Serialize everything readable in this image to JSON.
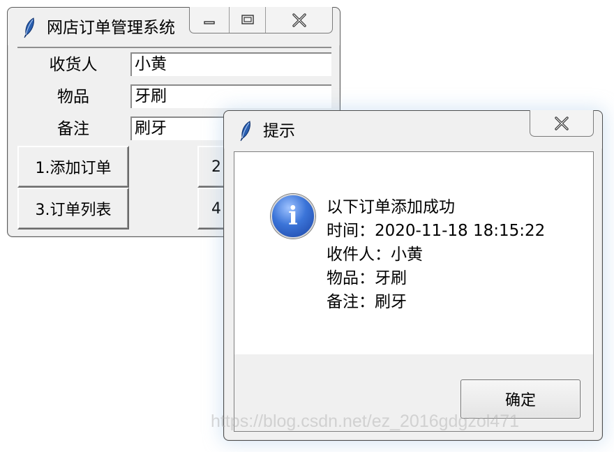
{
  "main_window": {
    "title": "网店订单管理系统",
    "fields": [
      {
        "label": "收货人",
        "value": "小黄"
      },
      {
        "label": "物品",
        "value": "牙刷"
      },
      {
        "label": "备注",
        "value": "刷牙"
      }
    ],
    "buttons": [
      {
        "label": "1.添加订单"
      },
      {
        "label": "2"
      },
      {
        "label": "3.订单列表"
      },
      {
        "label": "4"
      }
    ]
  },
  "dialog": {
    "title": "提示",
    "icon": "info-icon",
    "icon_glyph": "i",
    "message_lines": [
      "以下订单添加成功",
      "时间：2020-11-18 18:15:22",
      "收件人：小黄",
      "物品：牙刷",
      "备注：刷牙"
    ],
    "ok_label": "确定"
  },
  "watermark": "https://blog.csdn.net/ez_2016gdgzol471"
}
